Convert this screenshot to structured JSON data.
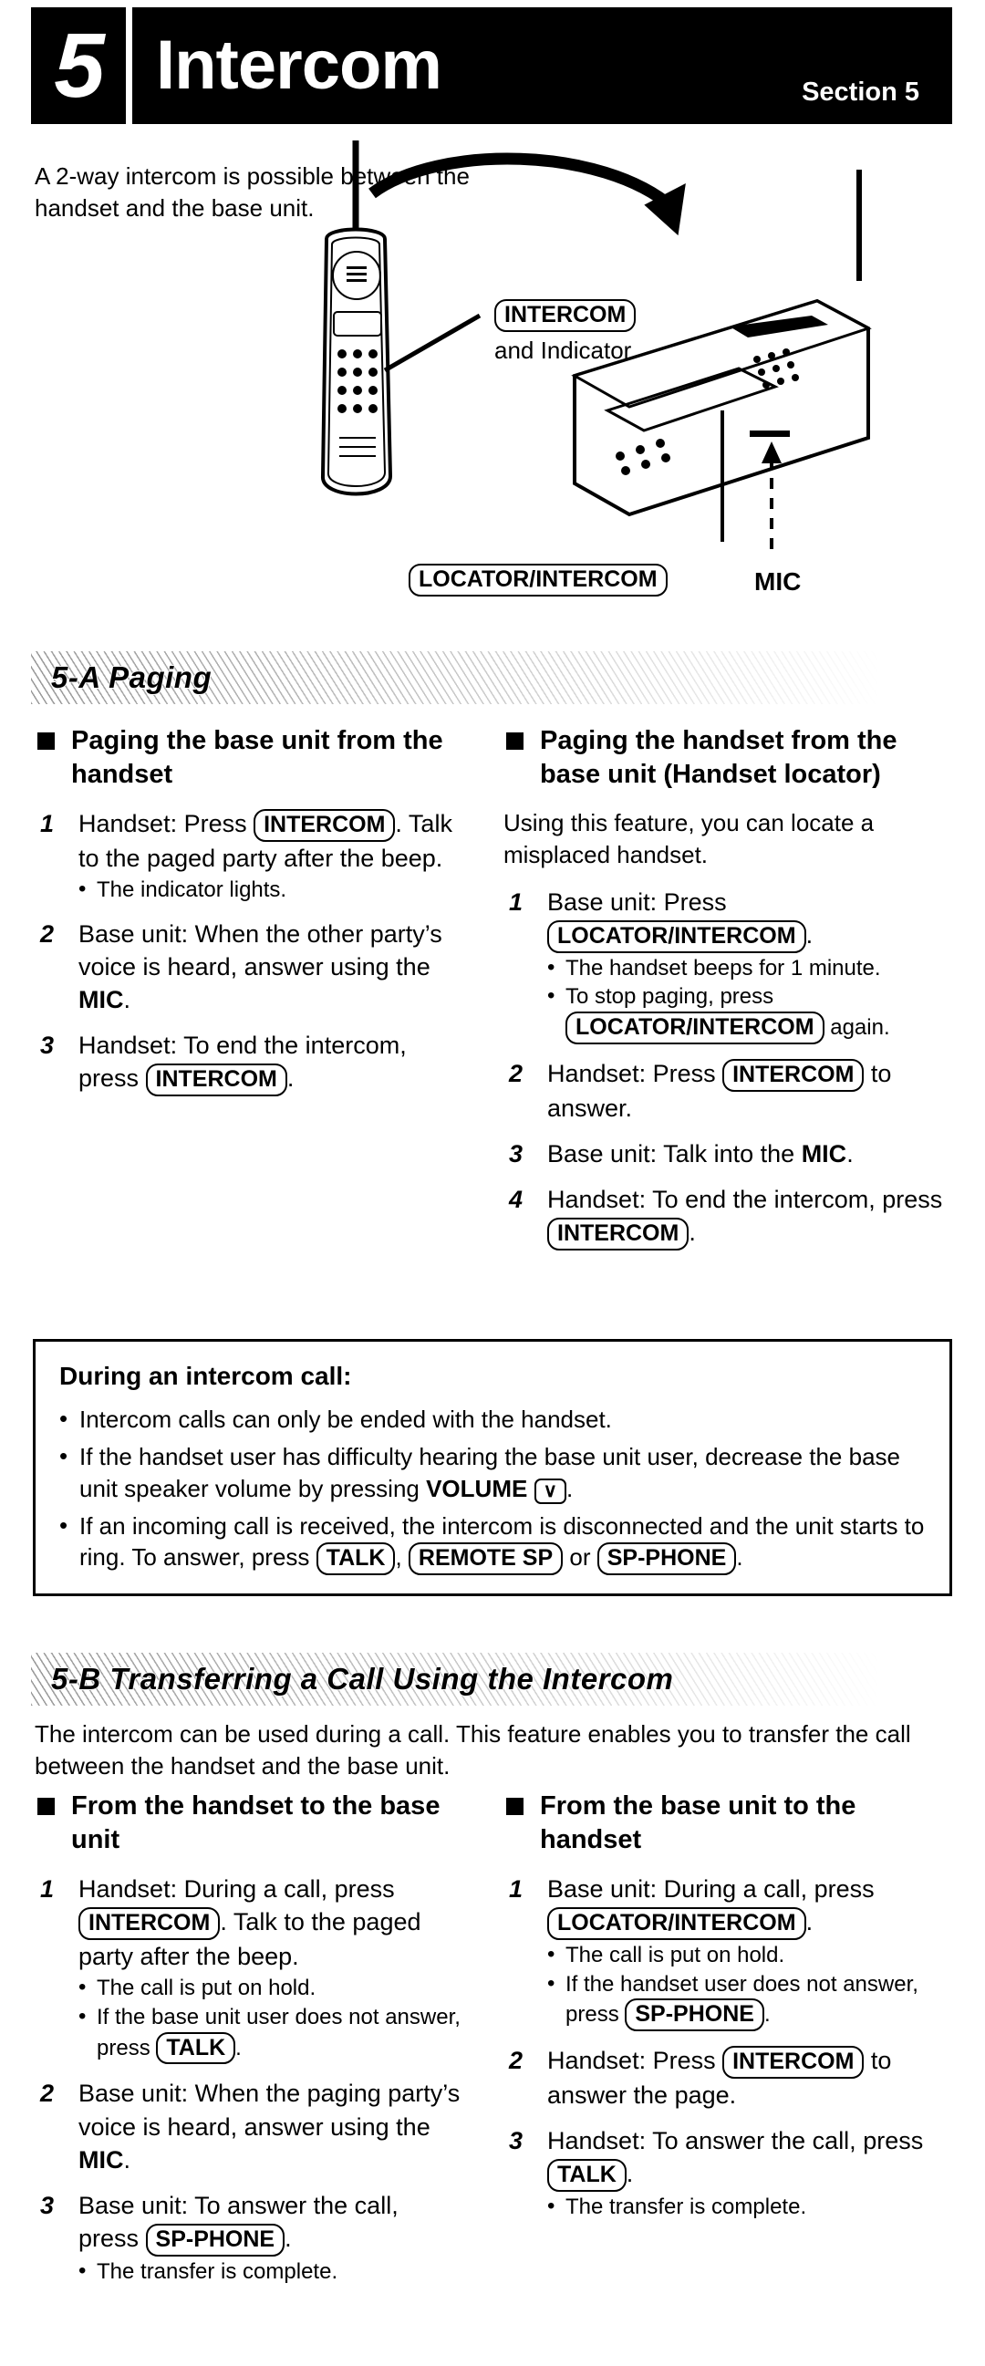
{
  "header": {
    "number": "5",
    "title": "Intercom",
    "section_label": "Section 5"
  },
  "intro": "A 2-way intercom is possible between the handset and the base unit.",
  "diagram": {
    "handset_key": "INTERCOM",
    "handset_key_sub": "and Indicator",
    "base_key": "LOCATOR/INTERCOM",
    "mic_label": "MIC"
  },
  "section_a": {
    "band_title": "5-A  Paging",
    "left": {
      "heading": "Paging the base unit from the handset",
      "steps": [
        {
          "num": "1",
          "parts": [
            {
              "t": "text",
              "v": "Handset: Press "
            },
            {
              "t": "key",
              "v": "INTERCOM"
            },
            {
              "t": "text",
              "v": ". Talk to the paged party after the beep."
            }
          ],
          "bullets": [
            "The indicator lights."
          ]
        },
        {
          "num": "2",
          "parts": [
            {
              "t": "text",
              "v": "Base unit: When the other party’s voice is heard, answer using the "
            },
            {
              "t": "bold",
              "v": "MIC"
            },
            {
              "t": "text",
              "v": "."
            }
          ],
          "bullets": []
        },
        {
          "num": "3",
          "parts": [
            {
              "t": "text",
              "v": "Handset: To end the intercom, press "
            },
            {
              "t": "key",
              "v": "INTERCOM"
            },
            {
              "t": "text",
              "v": "."
            }
          ],
          "bullets": []
        }
      ]
    },
    "right": {
      "heading": "Paging the handset from the base unit (Handset locator)",
      "lead": "Using this feature, you can locate a misplaced handset.",
      "steps": [
        {
          "num": "1",
          "parts": [
            {
              "t": "text",
              "v": "Base unit: Press "
            },
            {
              "t": "key",
              "v": "LOCATOR/INTERCOM"
            },
            {
              "t": "text",
              "v": "."
            }
          ],
          "bullets_rich": [
            [
              {
                "t": "text",
                "v": "The handset beeps for 1 minute."
              }
            ],
            [
              {
                "t": "text",
                "v": "To stop paging, press "
              },
              {
                "t": "key",
                "v": "LOCATOR/INTERCOM"
              },
              {
                "t": "text",
                "v": " again."
              }
            ]
          ]
        },
        {
          "num": "2",
          "parts": [
            {
              "t": "text",
              "v": "Handset: Press "
            },
            {
              "t": "key",
              "v": "INTERCOM"
            },
            {
              "t": "text",
              "v": " to answer."
            }
          ],
          "bullets": []
        },
        {
          "num": "3",
          "parts": [
            {
              "t": "text",
              "v": "Base unit: Talk into the "
            },
            {
              "t": "bold",
              "v": "MIC"
            },
            {
              "t": "text",
              "v": "."
            }
          ],
          "bullets": []
        },
        {
          "num": "4",
          "parts": [
            {
              "t": "text",
              "v": "Handset: To end the intercom, press "
            },
            {
              "t": "key",
              "v": "INTERCOM"
            },
            {
              "t": "text",
              "v": "."
            }
          ],
          "bullets": []
        }
      ]
    },
    "notebox": {
      "title": "During an intercom call:",
      "bullets": [
        [
          {
            "t": "text",
            "v": "Intercom calls can only be ended with the handset."
          }
        ],
        [
          {
            "t": "text",
            "v": "If the handset user has difficulty hearing the base unit user, decrease the base unit speaker volume by pressing "
          },
          {
            "t": "bold",
            "v": "VOLUME"
          },
          {
            "t": "text",
            "v": " "
          },
          {
            "t": "key-chev",
            "v": "∨"
          },
          {
            "t": "text",
            "v": "."
          }
        ],
        [
          {
            "t": "text",
            "v": "If an incoming call is received, the intercom is disconnected and the unit starts to ring. To answer, press "
          },
          {
            "t": "key",
            "v": "TALK"
          },
          {
            "t": "text",
            "v": ", "
          },
          {
            "t": "key",
            "v": "REMOTE SP"
          },
          {
            "t": "text",
            "v": " or "
          },
          {
            "t": "key",
            "v": "SP-PHONE"
          },
          {
            "t": "text",
            "v": "."
          }
        ]
      ]
    }
  },
  "section_b": {
    "band_title": "5-B  Transferring a Call Using the Intercom",
    "intro": "The intercom can be used during a call. This feature enables you to transfer the call between the handset and the base unit.",
    "left": {
      "heading": "From the handset to the base unit",
      "steps": [
        {
          "num": "1",
          "parts": [
            {
              "t": "text",
              "v": "Handset: During a call, press "
            },
            {
              "t": "key",
              "v": "INTERCOM"
            },
            {
              "t": "text",
              "v": ". Talk to the paged party after the beep."
            }
          ],
          "bullets_rich": [
            [
              {
                "t": "text",
                "v": "The call is put on hold."
              }
            ],
            [
              {
                "t": "text",
                "v": "If the base unit user does not answer, press "
              },
              {
                "t": "key",
                "v": "TALK"
              },
              {
                "t": "text",
                "v": "."
              }
            ]
          ]
        },
        {
          "num": "2",
          "parts": [
            {
              "t": "text",
              "v": "Base unit: When the paging party’s voice is heard, answer using the "
            },
            {
              "t": "bold",
              "v": "MIC"
            },
            {
              "t": "text",
              "v": "."
            }
          ],
          "bullets": []
        },
        {
          "num": "3",
          "parts": [
            {
              "t": "text",
              "v": "Base unit: To answer the call, press "
            },
            {
              "t": "key",
              "v": "SP-PHONE"
            },
            {
              "t": "text",
              "v": "."
            }
          ],
          "bullets": [
            "The transfer is complete."
          ]
        }
      ]
    },
    "right": {
      "heading": "From the base unit to the handset",
      "steps": [
        {
          "num": "1",
          "parts": [
            {
              "t": "text",
              "v": "Base unit: During a call, press "
            },
            {
              "t": "key",
              "v": "LOCATOR/INTERCOM"
            },
            {
              "t": "text",
              "v": "."
            }
          ],
          "bullets_rich": [
            [
              {
                "t": "text",
                "v": "The call is put on hold."
              }
            ],
            [
              {
                "t": "text",
                "v": "If the handset user does not answer, press "
              },
              {
                "t": "key",
                "v": "SP-PHONE"
              },
              {
                "t": "text",
                "v": "."
              }
            ]
          ]
        },
        {
          "num": "2",
          "parts": [
            {
              "t": "text",
              "v": "Handset: Press "
            },
            {
              "t": "key",
              "v": "INTERCOM"
            },
            {
              "t": "text",
              "v": " to answer the page."
            }
          ],
          "bullets": []
        },
        {
          "num": "3",
          "parts": [
            {
              "t": "text",
              "v": "Handset: To answer the call, press "
            },
            {
              "t": "key",
              "v": "TALK"
            },
            {
              "t": "text",
              "v": "."
            }
          ],
          "bullets": [
            "The transfer is complete."
          ]
        }
      ]
    }
  }
}
